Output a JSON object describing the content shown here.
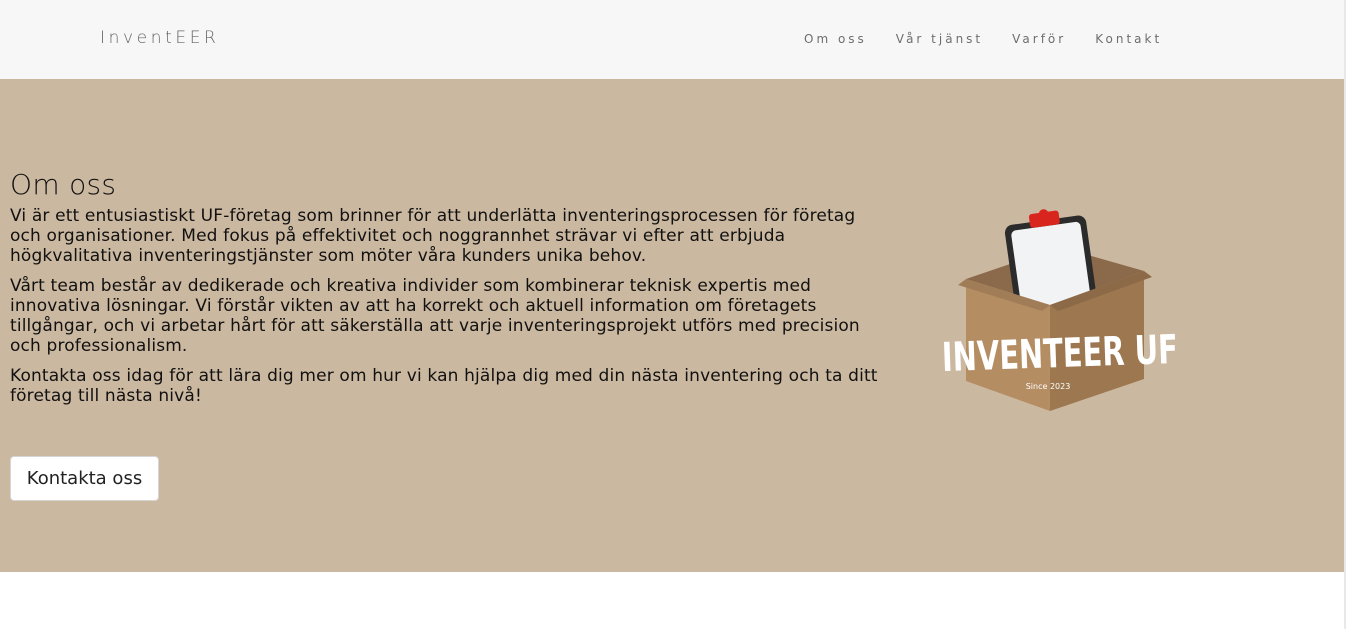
{
  "navbar": {
    "brand": "InventEER",
    "links": [
      "Om oss",
      "Vår tjänst",
      "Varför",
      "Kontakt"
    ]
  },
  "hero": {
    "title": "Om oss",
    "paragraphs": [
      "Vi är ett entusiastiskt UF-företag som brinner för att underlätta inventeringsprocessen för företag och organisationer. Med fokus på effektivitet och noggrannhet strävar vi efter att erbjuda högkvalitativa inventeringstjänster som möter våra kunders unika behov.",
      "Vårt team består av dedikerade och kreativa individer som kombinerar teknisk expertis med innovativa lösningar. Vi förstår vikten av att ha korrekt och aktuell information om företagets tillgångar, och vi arbetar hårt för att säkerställa att varje inventeringsprojekt utförs med precision och professionalism.",
      "Kontakta oss idag för att lära dig mer om hur vi kan hjälpa dig med din nästa inventering och ta ditt företag till nästa nivå!"
    ],
    "cta_label": "Kontakta oss",
    "background_color": "#cbb8a0"
  },
  "logo": {
    "text": "INVENTEER UF",
    "subtext": "Since 2023",
    "icon": "clipboard-in-box-icon"
  }
}
